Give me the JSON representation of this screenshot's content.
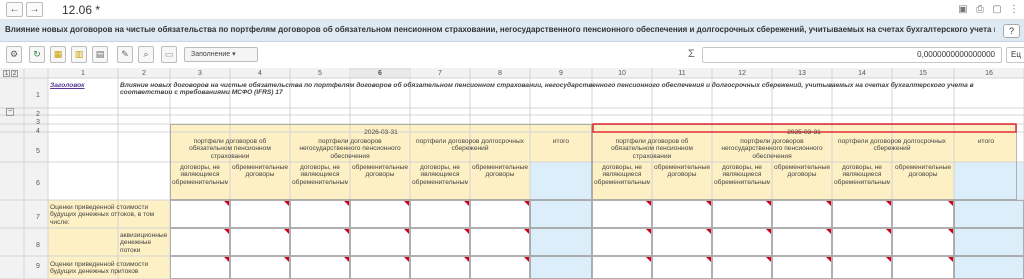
{
  "window": {
    "nav_back": "←",
    "nav_forward": "→",
    "doc_title": "12.06 *",
    "top_icons": [
      "floppy-icon",
      "printer-icon",
      "preview-icon",
      "more-icon"
    ]
  },
  "title_bar": {
    "text": "Влияние новых договоров на чистые обязательства по портфелям договоров об обязательном пенсионном страховании, негосударственного пенсионного обеспечения и долгосрочных сбережений, учитываемых на счетах бухгалтерского учета в соотв...",
    "help_label": "?"
  },
  "toolbar": {
    "fill_label": "Заполнение ▾",
    "sigma": "Σ",
    "sum_value": "0,0000000000000000",
    "extra_label": "Ец"
  },
  "grid": {
    "outline_labels": [
      "1",
      "2"
    ],
    "collapse_label": "−",
    "column_numbers": [
      "1",
      "2",
      "3",
      "4",
      "5",
      "6",
      "7",
      "8",
      "9",
      "10",
      "11",
      "12",
      "13",
      "14",
      "15",
      "16"
    ],
    "row_numbers": [
      "1",
      "2",
      "3",
      "4",
      "5",
      "6",
      "7",
      "8",
      "9"
    ],
    "header_link": "Заголовок",
    "report_title": "Влияние новых договоров на чистые обязательства по портфелям договоров об обязательном пенсионном страховании, негосударственного пенсионного обеспечения и долгосрочных сбережений, учитываемых на счетах бухгалтерского учета в соответствии с требованиями МСФО (IFRS) 17",
    "date_left": "2026-03-31",
    "date_right": "2025-03-31",
    "portfolio_ops": "портфели договоров об обязательном пенсионном страховании",
    "portfolio_npo": "портфели договоров негосударственного пенсионного обеспечения",
    "portfolio_ds": "портфели договоров долгосрочных сбережений",
    "total": "итого",
    "not_onerous": "договоры, не являющиеся обременительными",
    "onerous": "обременительные договоры",
    "row7_label": "Оценки приведенной стоимости будущих денежных оттоков, в том числе:",
    "row8_label": "аквизиционные денежные потоки",
    "row9_label": "Оценки приведенной стоимости будущих денежных притоков"
  }
}
